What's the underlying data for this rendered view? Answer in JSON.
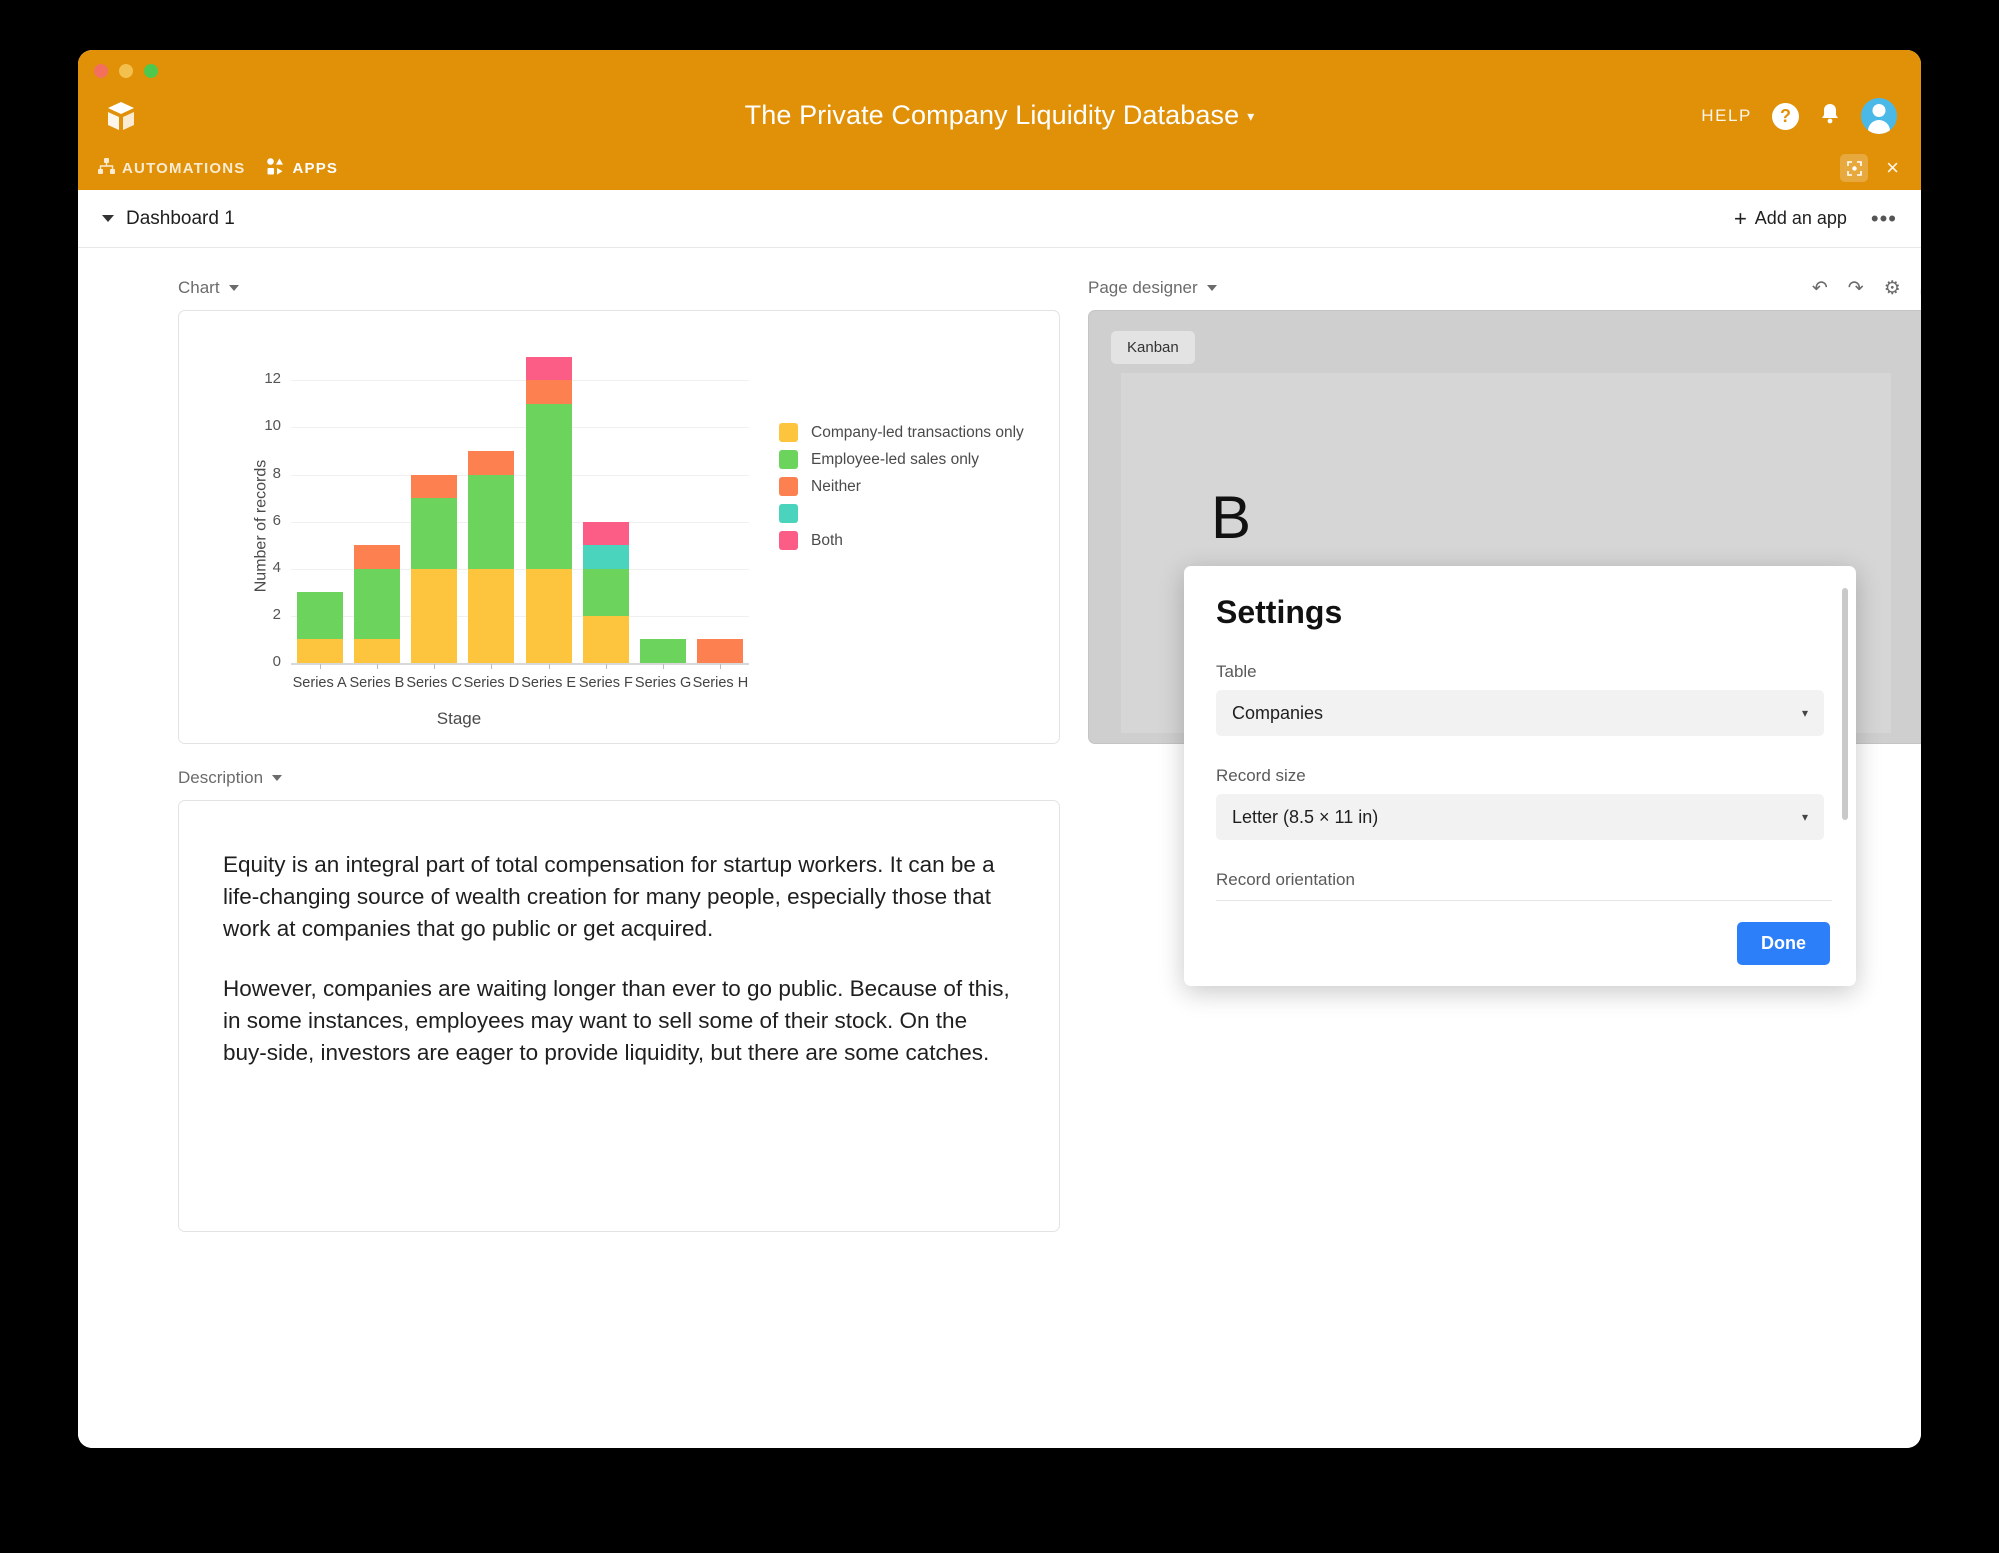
{
  "window": {
    "title": "The Private Company Liquidity Database",
    "title_caret": "▾",
    "help_label": "HELP",
    "help_icon_glyph": "?",
    "bell_icon_glyph": "•",
    "nav": {
      "automations": "AUTOMATIONS",
      "apps": "APPS"
    },
    "close_glyph": "×"
  },
  "dashboard_bar": {
    "title": "Dashboard 1",
    "add_app_label": "Add an app",
    "add_app_plus": "+",
    "overflow_glyph": "•••"
  },
  "chart_panel": {
    "label": "Chart"
  },
  "page_designer_panel": {
    "label": "Page designer",
    "kanban_chip": "Kanban",
    "big_letter": "B",
    "icons": {
      "undo": "↶",
      "redo": "↷",
      "gear": "⚙",
      "expand": "⛶",
      "drag": "⠿",
      "print": "⎙"
    }
  },
  "settings_modal": {
    "title": "Settings",
    "table_label": "Table",
    "table_value": "Companies",
    "record_size_label": "Record size",
    "record_size_value": "Letter (8.5 × 11 in)",
    "record_orientation_label": "Record orientation",
    "done_label": "Done",
    "caret": "▾",
    "accent_color": "#2d7ff9"
  },
  "description_panel": {
    "label": "Description",
    "paragraph_1": "Equity is an integral part of total compensation for startup workers. It can be a life-changing source of wealth creation for many people, especially those that work at companies that go public or get acquired.",
    "paragraph_2": "However, companies are waiting longer than ever to go public. Because of this, in some instances, employees may want to sell some of their stock. On the buy-side, investors are eager to provide liquidity, but there are some catches."
  },
  "chart_data": {
    "type": "bar",
    "stacked": true,
    "title": "",
    "xlabel": "Stage",
    "ylabel": "Number of records",
    "categories": [
      "Series A",
      "Series B",
      "Series C",
      "Series D",
      "Series E",
      "Series F",
      "Series G",
      "Series H"
    ],
    "yticks": [
      0,
      2,
      4,
      6,
      8,
      10,
      12
    ],
    "ylim": [
      0,
      13.5
    ],
    "grid": true,
    "legend_position": "right",
    "series": [
      {
        "name": "Company-led transactions only",
        "color": "#fdc53e",
        "values": [
          1,
          1,
          4,
          4,
          4,
          2,
          0,
          0
        ]
      },
      {
        "name": "Employee-led sales only",
        "color": "#6cd45c",
        "values": [
          2,
          3,
          3,
          4,
          7,
          2,
          1,
          0
        ]
      },
      {
        "name": "Neither",
        "color": "#fc8050",
        "values": [
          0,
          1,
          1,
          1,
          1,
          0,
          0,
          1
        ]
      },
      {
        "name": "",
        "color": "#4bd4bd",
        "values": [
          0,
          0,
          0,
          0,
          0,
          1,
          0,
          0
        ]
      },
      {
        "name": "Both",
        "color": "#fc5d86",
        "values": [
          0,
          0,
          0,
          0,
          1,
          1,
          0,
          0
        ]
      }
    ],
    "totals": [
      3,
      5,
      8,
      9,
      13,
      6,
      1,
      1
    ]
  },
  "colors": {
    "brand_orange": "#e09108",
    "accent_blue": "#2d7ff9",
    "avatar_blue": "#4bb9e8"
  }
}
